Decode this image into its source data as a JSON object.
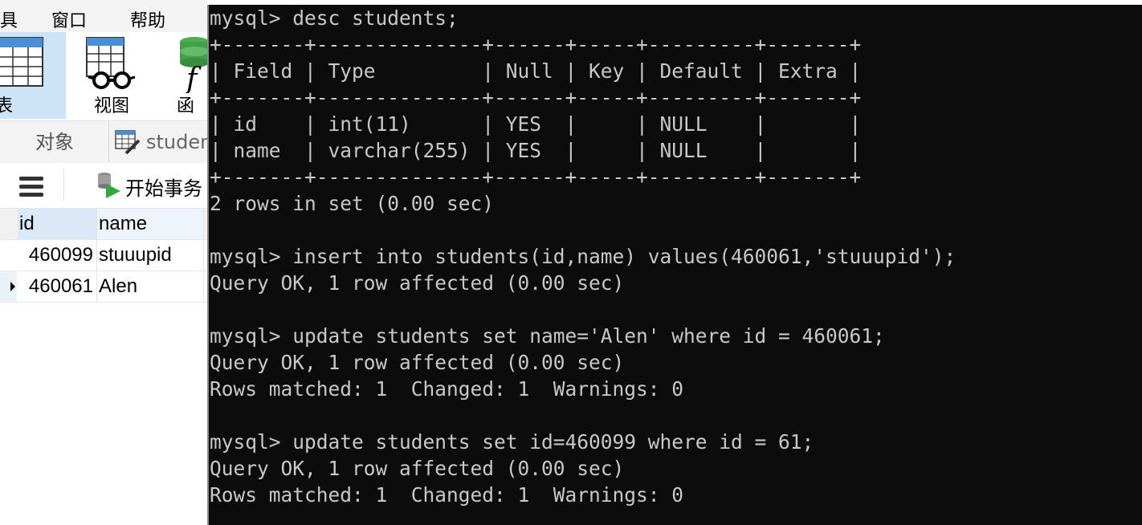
{
  "menubar": {
    "items": [
      "具",
      "窗口",
      "帮助"
    ]
  },
  "toolbar": {
    "table_label": "表",
    "view_label": "视图",
    "function_label": "函"
  },
  "object_bar": {
    "objects_tab": "对象",
    "table_tab": "studen"
  },
  "action_bar": {
    "begin_transaction": "开始事务"
  },
  "grid": {
    "columns": [
      "id",
      "name"
    ],
    "rows": [
      {
        "id": "460099",
        "name": "stuuupid"
      },
      {
        "id": "460061",
        "name": "Alen"
      }
    ]
  },
  "terminal": {
    "lines": [
      "mysql> desc students;",
      "+-------+--------------+------+-----+---------+-------+",
      "| Field | Type         | Null | Key | Default | Extra |",
      "+-------+--------------+------+-----+---------+-------+",
      "| id    | int(11)      | YES  |     | NULL    |       |",
      "| name  | varchar(255) | YES  |     | NULL    |       |",
      "+-------+--------------+------+-----+---------+-------+",
      "2 rows in set (0.00 sec)",
      "",
      "mysql> insert into students(id,name) values(460061,'stuuupid');",
      "Query OK, 1 row affected (0.00 sec)",
      "",
      "mysql> update students set name='Alen' where id = 460061;",
      "Query OK, 1 row affected (0.00 sec)",
      "Rows matched: 1  Changed: 1  Warnings: 0",
      "",
      "mysql> update students set id=460099 where id = 61;",
      "Query OK, 1 row affected (0.00 sec)",
      "Rows matched: 1  Changed: 1  Warnings: 0"
    ]
  }
}
